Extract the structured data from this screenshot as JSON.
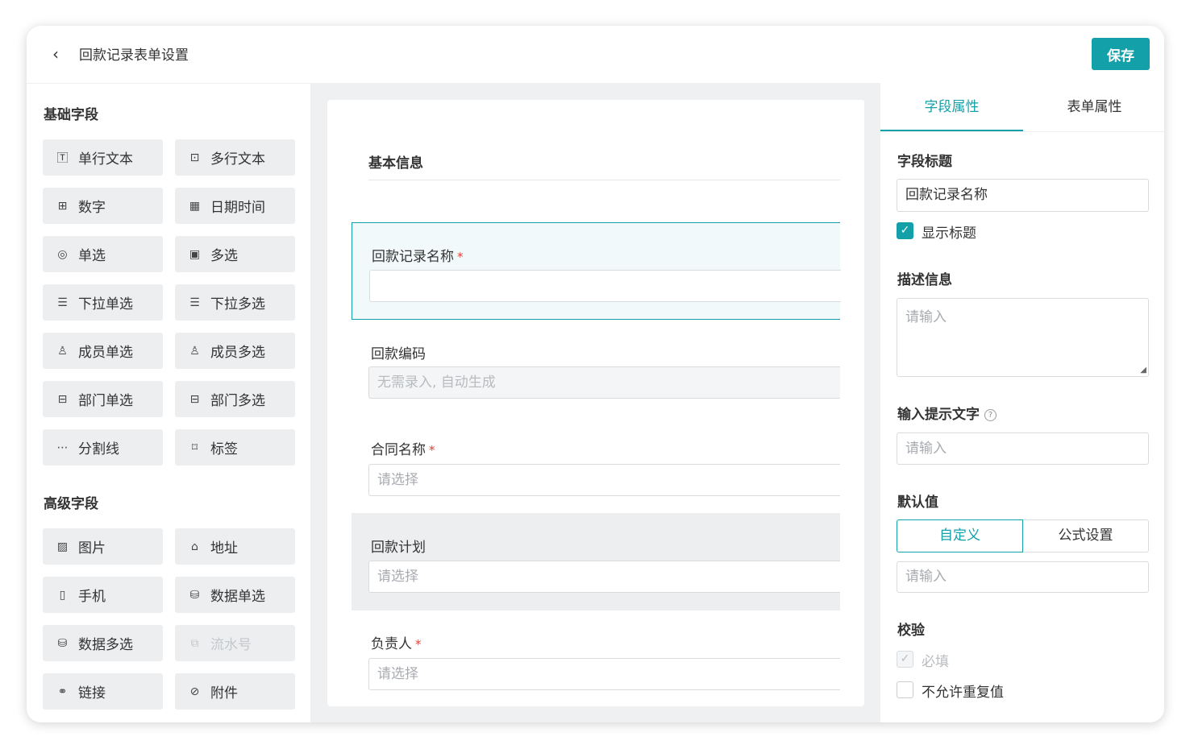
{
  "header": {
    "back_icon": "chevron-left-icon",
    "title": "回款记录表单设置",
    "save_label": "保存"
  },
  "palette": {
    "basic_title": "基础字段",
    "basic": [
      {
        "label": "单行文本",
        "icon": "text-icon"
      },
      {
        "label": "多行文本",
        "icon": "textarea-icon"
      },
      {
        "label": "数字",
        "icon": "number-icon"
      },
      {
        "label": "日期时间",
        "icon": "calendar-icon"
      },
      {
        "label": "单选",
        "icon": "radio-icon"
      },
      {
        "label": "多选",
        "icon": "checkbox-icon"
      },
      {
        "label": "下拉单选",
        "icon": "list-icon"
      },
      {
        "label": "下拉多选",
        "icon": "list-icon"
      },
      {
        "label": "成员单选",
        "icon": "user-icon"
      },
      {
        "label": "成员多选",
        "icon": "user-icon"
      },
      {
        "label": "部门单选",
        "icon": "department-icon"
      },
      {
        "label": "部门多选",
        "icon": "department-icon"
      },
      {
        "label": "分割线",
        "icon": "divider-icon"
      },
      {
        "label": "标签",
        "icon": "tag-icon"
      }
    ],
    "advanced_title": "高级字段",
    "advanced": [
      {
        "label": "图片",
        "icon": "image-icon"
      },
      {
        "label": "地址",
        "icon": "map-icon"
      },
      {
        "label": "手机",
        "icon": "phone-icon"
      },
      {
        "label": "数据单选",
        "icon": "database-icon"
      },
      {
        "label": "数据多选",
        "icon": "database-icon"
      },
      {
        "label": "流水号",
        "icon": "serial-icon",
        "disabled": true
      },
      {
        "label": "链接",
        "icon": "link-icon"
      },
      {
        "label": "附件",
        "icon": "attachment-icon"
      }
    ]
  },
  "form": {
    "section_title": "基本信息",
    "fields": [
      {
        "label": "回款记录名称",
        "required": true,
        "placeholder": ""
      },
      {
        "label": "回款编码",
        "required": false,
        "placeholder": "无需录入, 自动生成"
      },
      {
        "label": "合同名称",
        "required": true,
        "placeholder": "请选择"
      },
      {
        "label": "回款计划",
        "required": false,
        "placeholder": "请选择"
      },
      {
        "label": "负责人",
        "required": true,
        "placeholder": "请选择"
      }
    ],
    "required_mark": "*"
  },
  "props": {
    "tabs": [
      "字段属性",
      "表单属性"
    ],
    "field_title_label": "字段标题",
    "field_title_value": "回款记录名称",
    "show_title_label": "显示标题",
    "desc_label": "描述信息",
    "desc_placeholder": "请输入",
    "hint_label": "输入提示文字",
    "hint_placeholder": "请输入",
    "default_label": "默认值",
    "default_modes": [
      "自定义",
      "公式设置"
    ],
    "default_placeholder": "请输入",
    "validate_label": "校验",
    "required_label": "必填",
    "no_dup_label": "不允许重复值",
    "accent": "#13a0a8"
  }
}
